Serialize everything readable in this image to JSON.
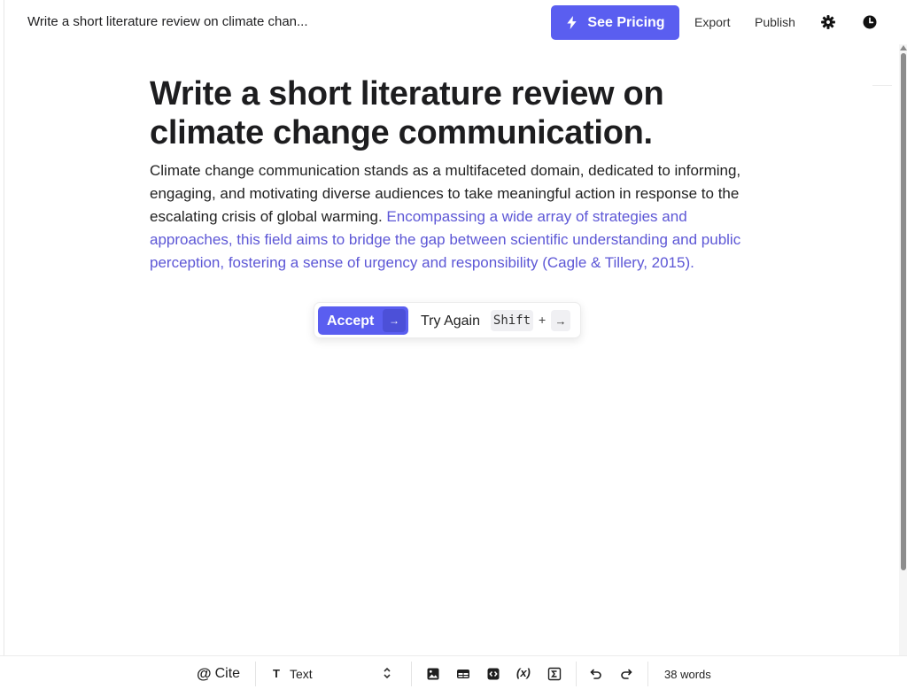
{
  "header": {
    "doc_title": "Write a short literature review on climate chan...",
    "pricing_label": "See Pricing",
    "export_label": "Export",
    "publish_label": "Publish",
    "icons": [
      "lightning-icon",
      "gear-icon",
      "clock-icon"
    ]
  },
  "document": {
    "heading": "Write a short literature review on climate change communication.",
    "paragraph_text": "Climate change communication stands as a multifaceted domain, dedicated to informing, engaging, and motivating diverse audiences to take meaningful action in response to the escalating crisis of global warming. ",
    "suggestion_text": "Encompassing a wide array of strategies and approaches, this field aims to bridge the gap between scientific understanding and public perception, fostering a sense of urgency and responsibility (Cagle & Tillery, 2015)."
  },
  "suggestion_popup": {
    "accept_label": "Accept",
    "accept_key": "→",
    "try_again_label": "Try Again",
    "shift_key": "Shift",
    "plus": "+",
    "arrow_key": "→"
  },
  "toolbar": {
    "cite_symbol": "@",
    "cite_label": "Cite",
    "text_style_icon": "T",
    "text_style_label": "Text",
    "variable_label": "(x)",
    "word_count": "38 words",
    "icons": [
      "image-icon",
      "table-icon",
      "code-block-icon",
      "variable-icon",
      "sum-icon",
      "undo-icon",
      "redo-icon",
      "chevron-updown-icon"
    ]
  },
  "colors": {
    "accent": "#5a5ef0",
    "suggestion_text": "#5d57d6",
    "text": "#1d1d1f"
  }
}
